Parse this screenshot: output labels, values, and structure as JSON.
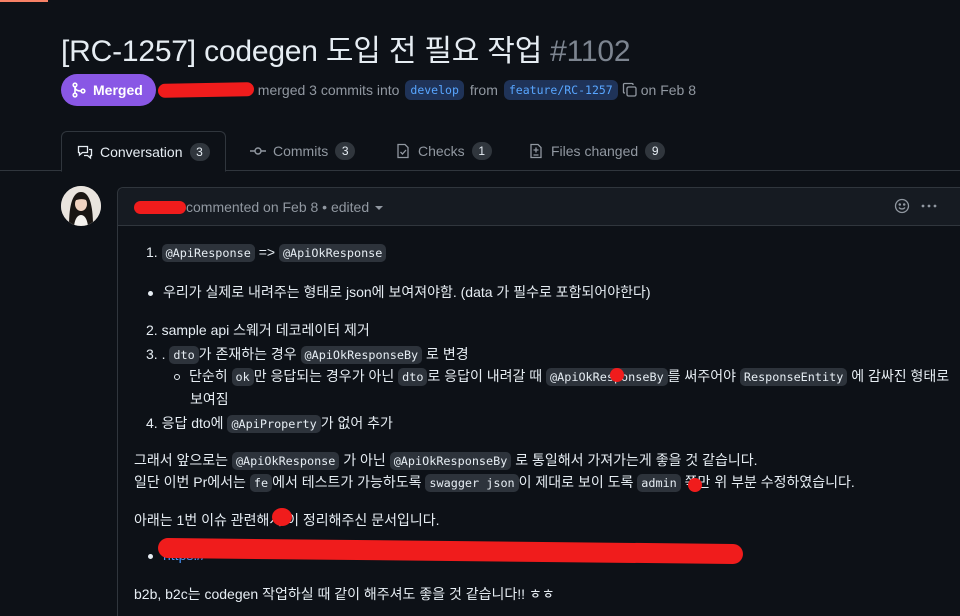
{
  "pr": {
    "title": "[RC-1257] codegen 도입 전 필요 작업",
    "number": "#1102",
    "status": "Merged",
    "merge_text": "merged 3 commits into",
    "base_branch": "develop",
    "from_text": "from",
    "head_branch": "feature/RC-1257",
    "date_text": "on Feb 8"
  },
  "tabs": [
    {
      "label": "Conversation",
      "count": "3",
      "icon": "comment-discussion-icon",
      "active": true
    },
    {
      "label": "Commits",
      "count": "3",
      "icon": "git-commit-icon"
    },
    {
      "label": "Checks",
      "count": "1",
      "icon": "checklist-icon"
    },
    {
      "label": "Files changed",
      "count": "9",
      "icon": "file-diff-icon"
    }
  ],
  "comment": {
    "header": "commented on Feb 8 • edited",
    "line1_num": "1.",
    "line1_code_a": "@ApiResponse",
    "line1_arrow": "=>",
    "line1_code_b": "@ApiOkResponse",
    "line2": "우리가 실제로 내려주는 형태로 json에 보여져야함. (data 가 필수로 포함되어야한다)",
    "line3": "2. sample api 스웨거 데코레이터 제거",
    "line4_a": "3. .",
    "line4_code_a": "dto",
    "line4_b": "가 존재하는 경우",
    "line4_code_b": "@ApiOkResponseBy",
    "line4_c": "로 변경",
    "line5_a": "단순히",
    "line5_code_a": "ok",
    "line5_b": "만 응답되는 경우가 아닌",
    "line5_code_b": "dto",
    "line5_c": "로 응답이 내려갈 때",
    "line5_code_c": "@ApiOkResponseBy",
    "line5_d": "를 써주어야",
    "line5_code_d": "ResponseEntity",
    "line5_e": "에 감싸진 형태로",
    "line6": "보여짐",
    "line7_a": "4. 응답 dto에",
    "line7_code": "@ApiProperty",
    "line7_b": "가 없어 추가",
    "line8_a": "그래서 앞으로는",
    "line8_code_a": "@ApiOkResponse",
    "line8_b": "가 아닌",
    "line8_code_b": "@ApiOkResponseBy",
    "line8_c": "로 통일해서 가져가는게 좋을 것 같습니다.",
    "line9_a": "일단 이번 Pr에서는",
    "line9_code_a": "fe",
    "line9_b": "에서 테스트가 가능하도록",
    "line9_code_b": "swagger json",
    "line9_c": "이 제대로 보이 도록",
    "line9_code_c": "admin",
    "line9_d": "쪽만 위 부분 수정하였습니다.",
    "line10": "아래는 1번 이슈 관련해서    이 정리해주신 문서입니다.",
    "link": "https://",
    "line11": "b2b, b2c는 codegen 작업하실 때 같이 해주셔도 좋을 것 같습니다!! ㅎㅎ"
  }
}
